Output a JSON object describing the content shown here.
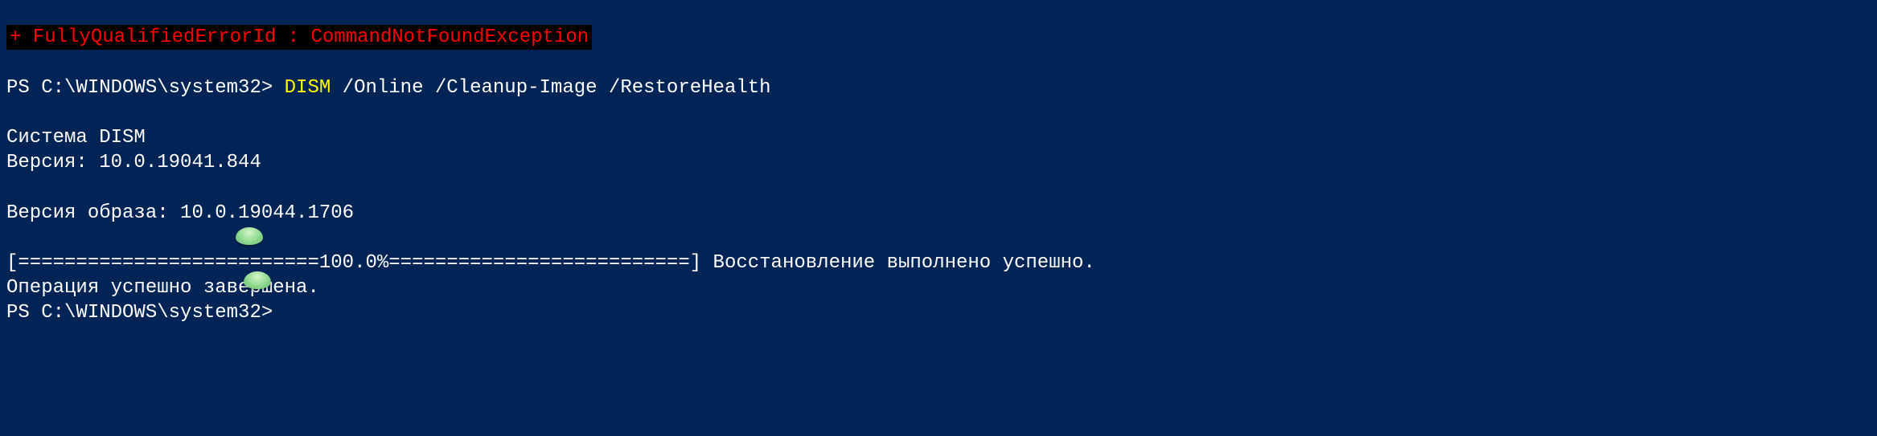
{
  "error": {
    "text": "+ FullyQualifiedErrorId : CommandNotFoundException"
  },
  "prompt1": {
    "path": "PS C:\\WINDOWS\\system32> ",
    "command": "DISM",
    "args": " /Online /Cleanup-Image /RestoreHealth"
  },
  "dism": {
    "title": "Система DISM",
    "version_line": "Версия: 10.0.19041.844",
    "image_version_line": "Версия образа: 10.0.19044.1706",
    "progress_line": "[==========================100.0%==========================] Восстановление выполнено успешно.",
    "done_line": "Операция успешно завершена."
  },
  "prompt2": {
    "path": "PS C:\\WINDOWS\\system32>"
  }
}
